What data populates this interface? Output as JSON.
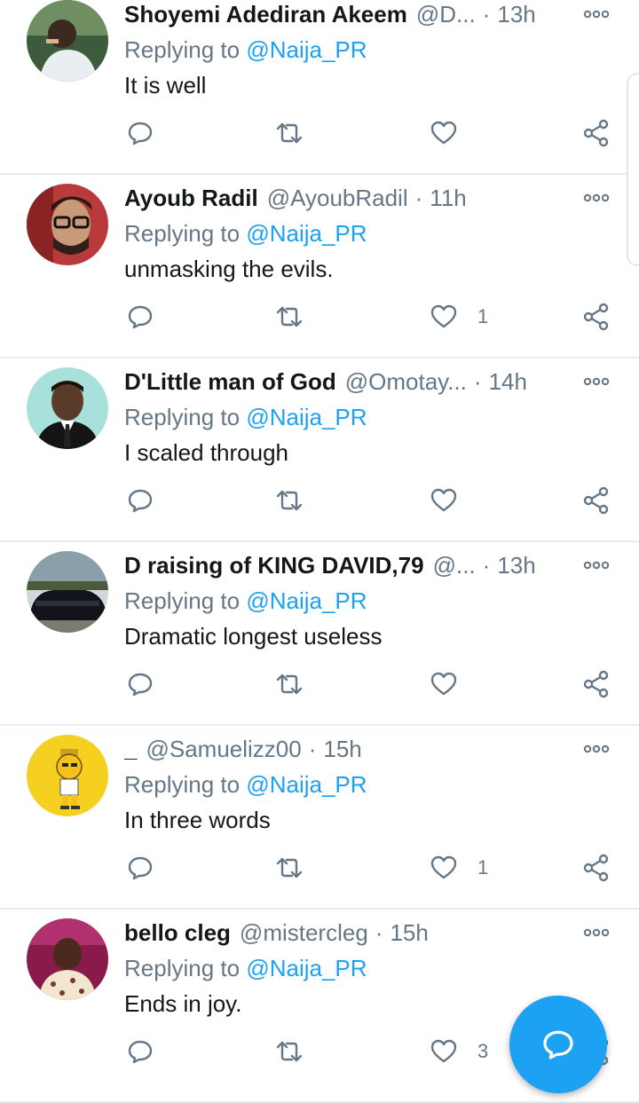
{
  "reply_prefix": "Replying to",
  "tweets": [
    {
      "name": "Shoyemi Adediran Akeem",
      "handle": "@D...",
      "time": "13h",
      "mention": "@Naija_PR",
      "text": "It is well",
      "likes": ""
    },
    {
      "name": "Ayoub Radil",
      "handle": "@AyoubRadil",
      "time": "11h",
      "mention": "@Naija_PR",
      "text": "unmasking the evils.",
      "likes": "1"
    },
    {
      "name": "D'Little man of God",
      "handle": "@Omotay...",
      "time": "14h",
      "mention": "@Naija_PR",
      "text": "I scaled through",
      "likes": ""
    },
    {
      "name": "D raising of KING DAVID,79",
      "handle": "@...",
      "time": "13h",
      "mention": "@Naija_PR",
      "text": "Dramatic longest useless",
      "likes": ""
    },
    {
      "name": "_",
      "handle": "@Samuelizz00",
      "time": "15h",
      "mention": "@Naija_PR",
      "text": "In three words",
      "likes": "1"
    },
    {
      "name": "bello cleg",
      "handle": "@mistercleg",
      "time": "15h",
      "mention": "@Naija_PR",
      "text": "Ends in joy.",
      "likes": "3"
    }
  ],
  "icons": {
    "reply": "reply-icon",
    "retweet": "retweet-icon",
    "like": "heart-icon",
    "share": "share-icon",
    "more": "more-options-icon",
    "compose": "compose-reply-icon"
  },
  "colors": {
    "accent": "#1da1f2",
    "muted": "#657786",
    "text": "#14171a",
    "divider": "#e6ecf0"
  }
}
